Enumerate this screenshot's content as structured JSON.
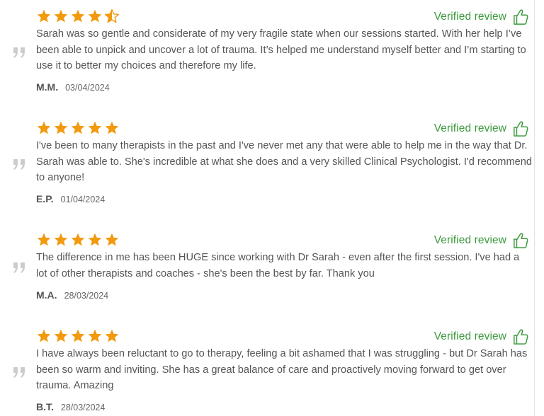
{
  "reviews": [
    {
      "rating": 4.5,
      "verified_label": "Verified review",
      "text": "Sarah was so gentle and considerate of my very fragile state when our sessions started. With her help I’ve been able to unpick and uncover a lot of trauma. It’s helped me understand myself better and I’m starting to use it to better my choices and therefore my life.",
      "author": "M.M.",
      "date": "03/04/2024"
    },
    {
      "rating": 5,
      "verified_label": "Verified review",
      "text": "I've been to many therapists in the past and I've never met any that were able to help me in the way that Dr. Sarah was able to. She's incredible at what she does and a very skilled Clinical Psychologist. I'd recommend to anyone!",
      "author": "E.P.",
      "date": "01/04/2024"
    },
    {
      "rating": 5,
      "verified_label": "Verified review",
      "text": "The difference in me has been HUGE since working with Dr Sarah - even after the first session. I've had a lot of other therapists and coaches - she's been the best by far. Thank you",
      "author": "M.A.",
      "date": "28/03/2024"
    },
    {
      "rating": 5,
      "verified_label": "Verified review",
      "text": "I have always been reluctant to go to therapy, feeling a bit ashamed that I was struggling - but Dr Sarah has been so warm and inviting. She has a great balance of care and proactively moving forward to get over trauma. Amazing",
      "author": "B.T.",
      "date": "28/03/2024"
    }
  ],
  "colors": {
    "star": "#f29a0e",
    "verified": "#3c9a3c",
    "text": "#555555",
    "quote": "#cccccc"
  },
  "icons": {
    "star": "star-icon",
    "half_star": "star-half-icon",
    "thumb": "thumbs-up-icon",
    "quote": "quote-icon"
  }
}
